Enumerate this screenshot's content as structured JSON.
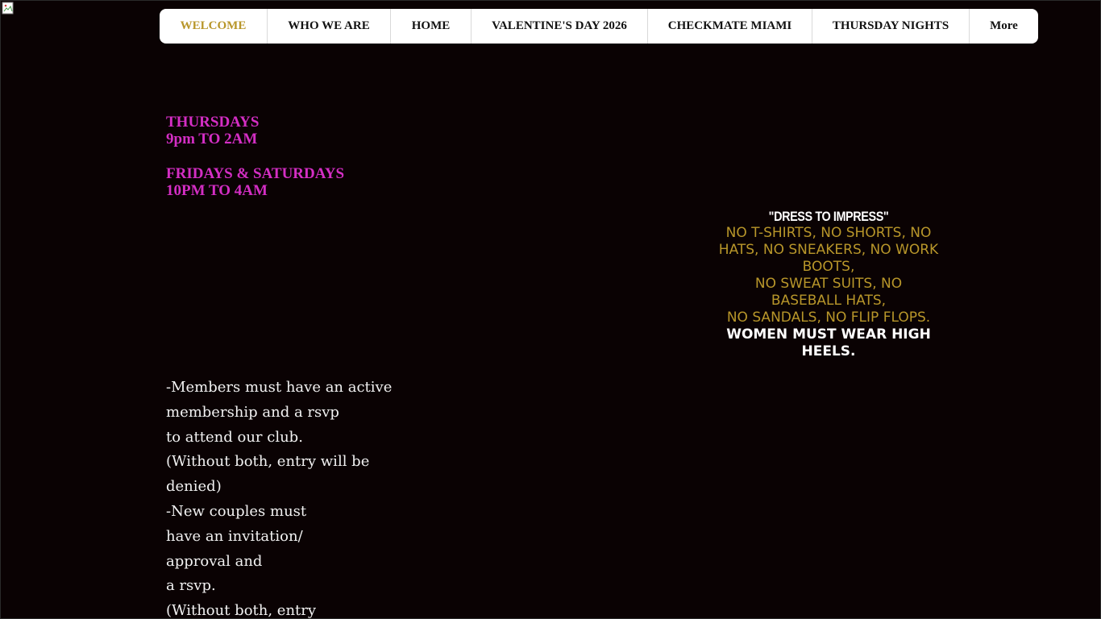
{
  "nav": {
    "items": [
      {
        "label": "WELCOME",
        "active": true
      },
      {
        "label": "WHO WE ARE",
        "active": false
      },
      {
        "label": "HOME",
        "active": false
      },
      {
        "label": "VALENTINE'S DAY 2026",
        "active": false
      },
      {
        "label": "CHECKMATE MIAMI",
        "active": false
      },
      {
        "label": "THURSDAY NIGHTS",
        "active": false
      },
      {
        "label": "More",
        "active": false
      }
    ]
  },
  "hours": {
    "thursday_day": "THURSDAYS",
    "thursday_time": "9pm TO 2AM",
    "weekend_day": "FRIDAYS & SATURDAYS",
    "weekend_time": "10PM TO 4AM"
  },
  "rules": {
    "lines": [
      "-Members must have an active",
      "membership and a rsvp",
      "to attend our club.",
      "(Without both, entry will be",
      "denied)",
      "-New couples must",
      "have an invitation/",
      "approval and",
      "a rsvp.",
      "(Without both, entry"
    ]
  },
  "dress_code": {
    "title": "\"DRESS TO IMPRESS\"",
    "gold_lines": [
      "NO T-SHIRTS, NO SHORTS, NO",
      "HATS, NO SNEAKERS, NO WORK",
      "BOOTS,",
      "NO SWEAT SUITS, NO",
      "BASEBALL HATS,",
      "NO SANDALS, NO FLIP FLOPS."
    ],
    "white_lines": [
      "WOMEN MUST WEAR HIGH",
      "HEELS."
    ]
  },
  "colors": {
    "background": "#0a0203",
    "nav_active": "#b8962a",
    "hours_magenta": "#d42ec4",
    "dress_gold": "#b8962a"
  }
}
